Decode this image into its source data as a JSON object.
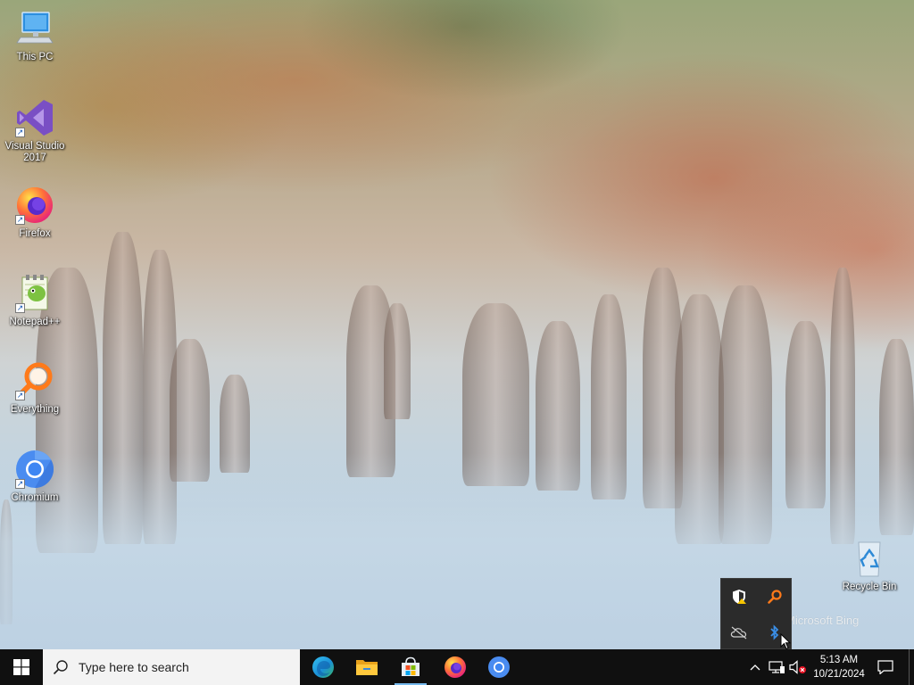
{
  "desktop": {
    "wallpaper_caption": "Microsoft Bing",
    "icons": [
      {
        "label": "This PC",
        "icon": "this-pc-icon",
        "shortcut": false
      },
      {
        "label": "Visual Studio\n2017",
        "icon": "visual-studio-icon",
        "shortcut": true
      },
      {
        "label": "Firefox",
        "icon": "firefox-icon",
        "shortcut": true
      },
      {
        "label": "Notepad++",
        "icon": "notepadpp-icon",
        "shortcut": true
      },
      {
        "label": "Everything",
        "icon": "everything-search-icon",
        "shortcut": true
      },
      {
        "label": "Chromium",
        "icon": "chromium-icon",
        "shortcut": true
      },
      {
        "label": "Recycle Bin",
        "icon": "recycle-bin-icon",
        "shortcut": false
      }
    ]
  },
  "tray_overflow": {
    "icons": [
      "windows-security-icon",
      "everything-tray-icon",
      "onedrive-offline-icon",
      "bluetooth-icon"
    ]
  },
  "taskbar": {
    "search_placeholder": "Type here to search",
    "pinned_apps": [
      "edge-icon",
      "file-explorer-icon",
      "microsoft-store-icon",
      "firefox-icon",
      "chromium-icon"
    ],
    "tray_icons": [
      "show-hidden-icons-chevron",
      "network-icon",
      "volume-muted-icon"
    ],
    "clock": {
      "time": "5:13 AM",
      "date": "10/21/2024"
    },
    "notification_icon": "action-center-icon"
  },
  "colors": {
    "taskbar_bg": "#101010",
    "search_bg": "#f3f3f3",
    "overflow_bg": "#2b2b2b",
    "accent": "#76b9ed"
  }
}
